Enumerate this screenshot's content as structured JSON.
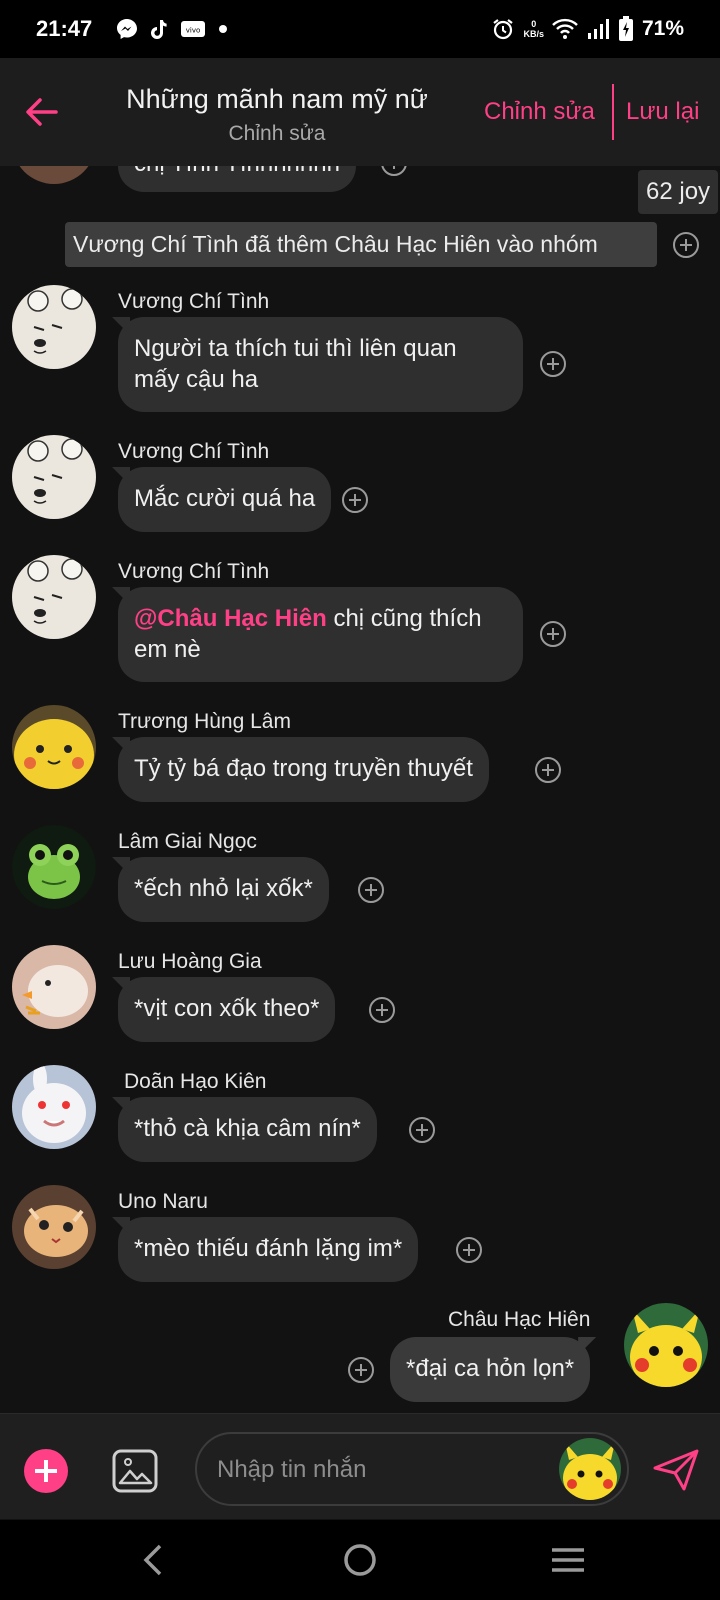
{
  "status_bar": {
    "time": "21:47",
    "app_icons": [
      "messenger-icon",
      "tiktok-icon",
      "vivo-icon",
      "dot-icon"
    ],
    "net_speed_value": "0",
    "net_speed_unit": "KB/s",
    "battery": "71%"
  },
  "header": {
    "title": "Những mãnh nam mỹ nữ",
    "subtitle": "Chỉnh sửa",
    "edit_label": "Chỉnh sửa",
    "save_label": "Lưu lại",
    "accent_color": "#ff3f86"
  },
  "top_partial": {
    "bubble_text": "chị Tình Tìnhhhhhh",
    "tag": "62 joy"
  },
  "system_note": "Vương Chí Tình đã thêm Châu Hạc Hiên vào nhóm",
  "messages": [
    {
      "sender": "Vương Chí Tình",
      "text": "Người ta thích tui thì liên quan mấy cậu ha",
      "avatar": "white-bear-avatar"
    },
    {
      "sender": "Vương Chí Tình",
      "text": "Mắc cười quá ha",
      "avatar": "white-bear-avatar"
    },
    {
      "sender": "Vương Chí Tình",
      "mention": "@Châu Hạc Hiên",
      "text": " chị cũng thích em nè",
      "avatar": "white-bear-avatar"
    },
    {
      "sender": "Trương Hùng Lâm",
      "text": "Tỷ tỷ bá đạo trong truyền thuyết",
      "avatar": "pikachu-plush-avatar"
    },
    {
      "sender": "Lâm Giai Ngọc",
      "text": "*ếch nhỏ lại xốk*",
      "avatar": "frog-avatar"
    },
    {
      "sender": "Lưu Hoàng Gia",
      "text": "*vịt con xốk theo*",
      "avatar": "duck-avatar"
    },
    {
      "sender": "Doãn Hạo Kiên",
      "text": "*thỏ cà khịa câm nín*",
      "avatar": "white-rabbit-avatar"
    },
    {
      "sender": "Uno Naru",
      "text": "*mèo thiếu đánh lặng im*",
      "avatar": "kitten-avatar"
    },
    {
      "sender": "Châu Hạc Hiên",
      "text": "*đại ca hỏn lọn*",
      "avatar": "pikachu-avatar",
      "own": true
    }
  ],
  "composer": {
    "placeholder": "Nhập tin nhắn"
  }
}
